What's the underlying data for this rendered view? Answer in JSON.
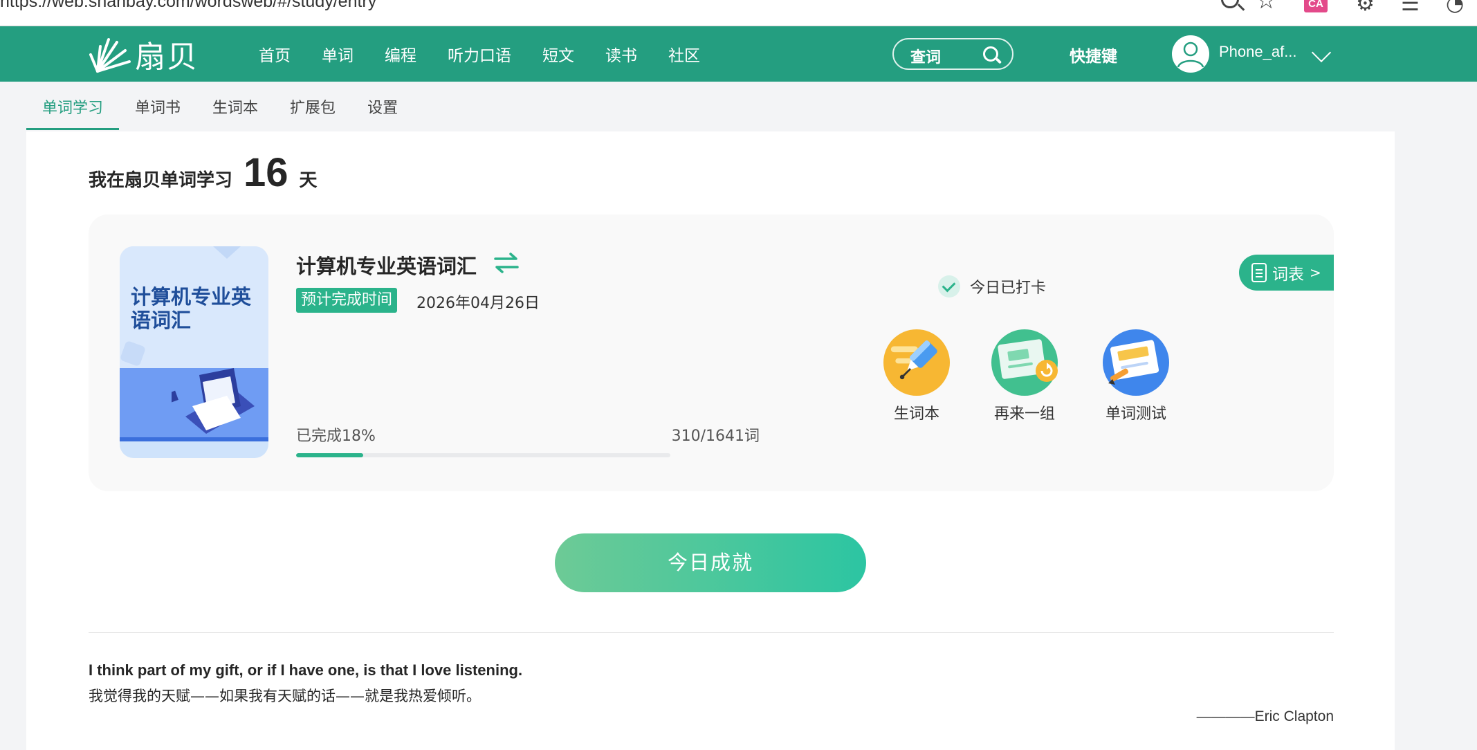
{
  "browser": {
    "url": "https://web.shanbay.com/wordsweb/#/study/entry",
    "ext_badge": "CA"
  },
  "nav": {
    "logo_text": "扇贝",
    "links": [
      "首页",
      "单词",
      "编程",
      "听力口语",
      "短文",
      "读书",
      "社区"
    ],
    "search_label": "查词",
    "shortcuts": "快捷键",
    "username": "Phone_af..."
  },
  "subtabs": {
    "items": [
      "单词学习",
      "单词书",
      "生词本",
      "扩展包",
      "设置"
    ],
    "active": "单词学习"
  },
  "study": {
    "days_prefix": "我在扇贝单词学习",
    "days": "16",
    "days_suffix": "天"
  },
  "book": {
    "cover_title": "计算机专业英语词汇",
    "title": "计算机专业英语词汇",
    "eta_label": "预计完成时间",
    "eta_date": "2026年04月26日",
    "progress_label": "已完成18%",
    "progress_count": "310/1641词",
    "progress_fraction": 0.18,
    "checkin_label": "今日已打卡",
    "wordlist_label": "词表",
    "wordlist_arrow": ">",
    "actions": [
      {
        "label": "生词本",
        "icon": "pen-icon"
      },
      {
        "label": "再来一组",
        "icon": "refresh-cards-icon"
      },
      {
        "label": "单词测试",
        "icon": "test-paper-icon"
      }
    ]
  },
  "achievement_label": "今日成就",
  "quote": {
    "en": "I think part of my gift, or if I have one, is that I love listening.",
    "zh": "我觉得我的天赋——如果我有天赋的话——就是我热爱倾听。",
    "author": "————Eric Clapton"
  },
  "colors": {
    "brand": "#249e80",
    "accent": "#2bb38b",
    "page_bg": "#f3f4f6"
  }
}
